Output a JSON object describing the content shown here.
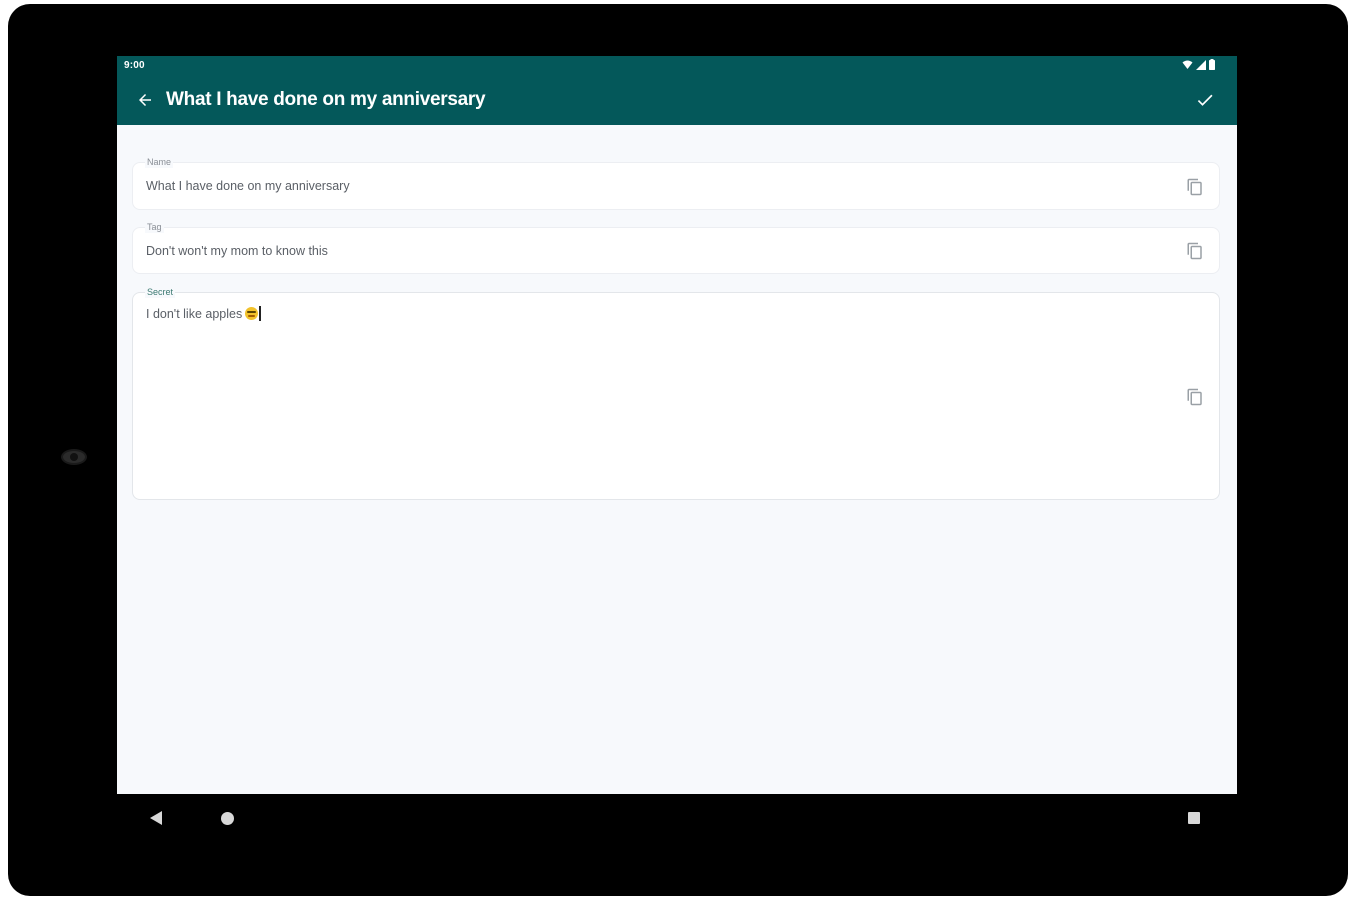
{
  "status_bar": {
    "time": "9:00"
  },
  "app_bar": {
    "title": "What I have done on my anniversary",
    "back_icon": "arrow-back-icon",
    "confirm_icon": "check-icon",
    "color": "#04585a"
  },
  "fields": {
    "name": {
      "label": "Name",
      "value": "What I have done on my anniversary"
    },
    "tag": {
      "label": "Tag",
      "value": "Don't won't my mom to know this"
    },
    "secret": {
      "label": "Secret",
      "value": "I don't like apples",
      "emoji": "grimacing-face-emoji"
    }
  },
  "copy_icon": "copy-icon",
  "nav_bar": {
    "back_icon": "nav-back-icon",
    "home_icon": "nav-home-icon",
    "recents_icon": "nav-recents-icon"
  }
}
